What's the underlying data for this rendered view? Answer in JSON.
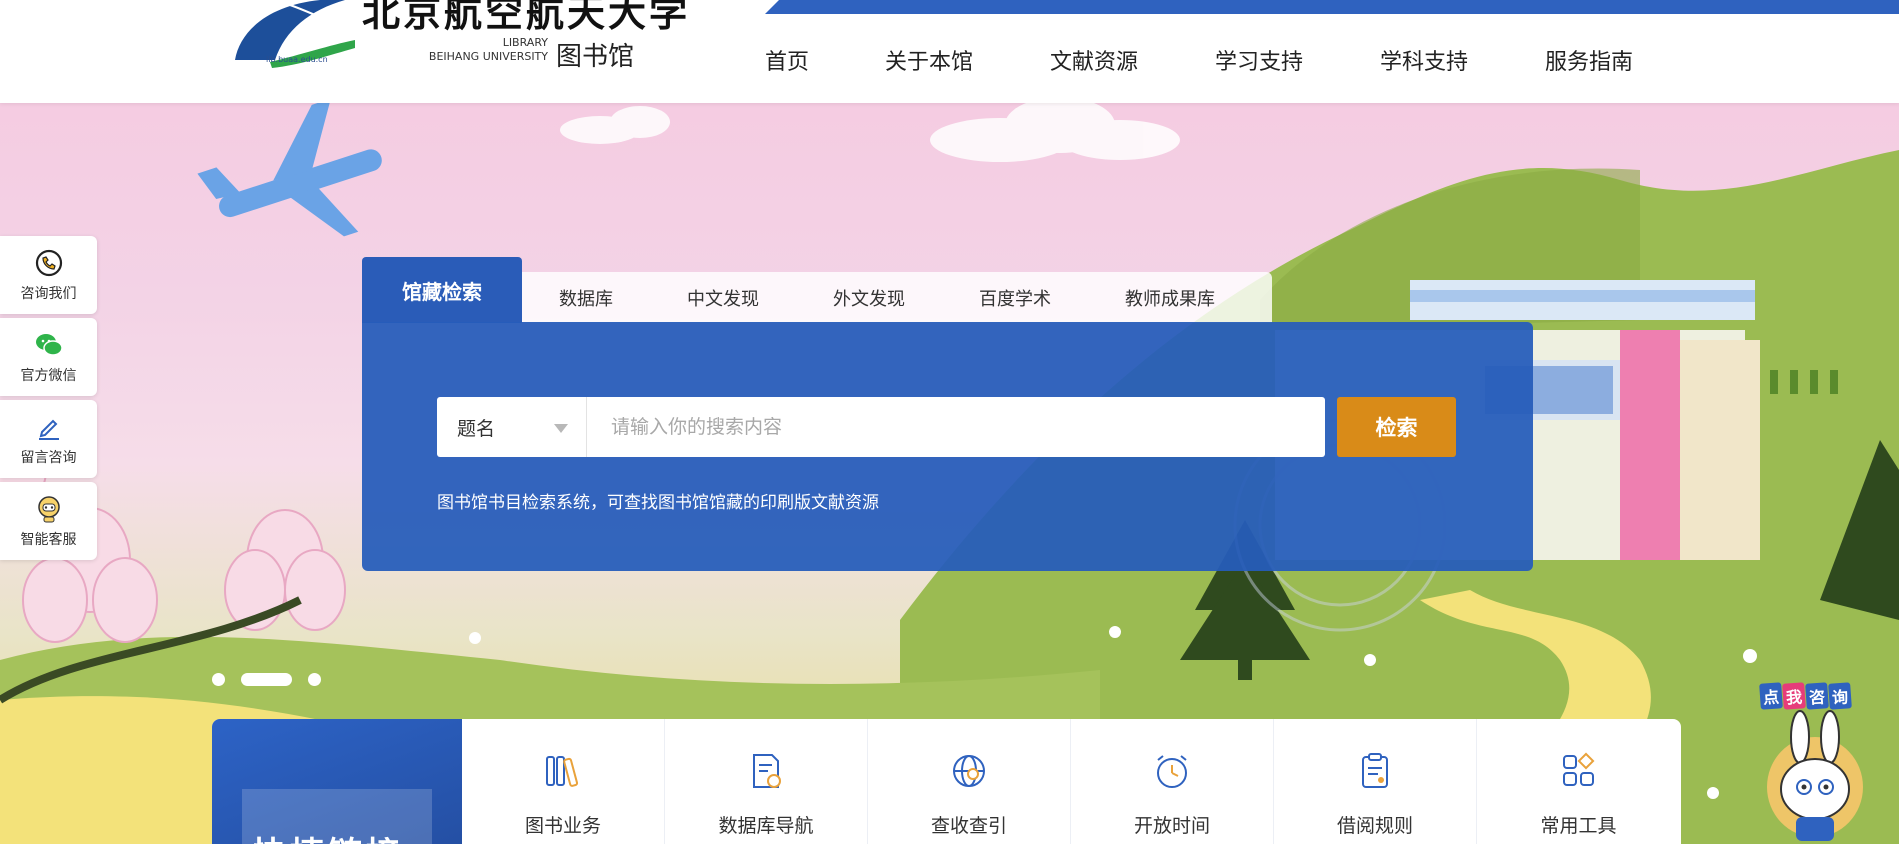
{
  "header": {
    "logo_url": "lib.buaa.edu.cn",
    "logo_name": "北京航空航天大学",
    "logo_lib_en_1": "LIBRARY",
    "logo_lib_en_2": "BEIHANG UNIVERSITY",
    "logo_lib_cn": "图书馆",
    "nav": [
      "首页",
      "关于本馆",
      "文献资源",
      "学习支持",
      "学科支持",
      "服务指南"
    ]
  },
  "float_left": [
    {
      "label": "咨询我们",
      "icon": "phone-chat-icon"
    },
    {
      "label": "官方微信",
      "icon": "wechat-icon"
    },
    {
      "label": "留言咨询",
      "icon": "pen-icon"
    },
    {
      "label": "智能客服",
      "icon": "robot-icon"
    }
  ],
  "search": {
    "tabs": [
      "馆藏检索",
      "数据库",
      "中文发现",
      "外文发现",
      "百度学术",
      "教师成果库"
    ],
    "active_tab": "馆藏检索",
    "field_select": "题名",
    "input_placeholder": "请输入你的搜索内容",
    "button": "检索",
    "description": "图书馆书目检索系统，可查找图书馆馆藏的印刷版文献资源"
  },
  "carousel": {
    "count": 3,
    "active_index": 1
  },
  "quick": {
    "title": "快捷链接",
    "items": [
      {
        "label": "图书业务",
        "icon": "books-icon"
      },
      {
        "label": "数据库导航",
        "icon": "database-doc-icon"
      },
      {
        "label": "查收查引",
        "icon": "globe-search-icon"
      },
      {
        "label": "开放时间",
        "icon": "alarm-clock-icon"
      },
      {
        "label": "借阅规则",
        "icon": "clipboard-icon"
      },
      {
        "label": "常用工具",
        "icon": "tools-grid-icon"
      }
    ]
  },
  "mascot": {
    "tag": [
      "点",
      "我",
      "咨",
      "询"
    ]
  },
  "colors": {
    "primary": "#2f62bf",
    "accent": "#d98b18",
    "icon_blue": "#2f62bf"
  }
}
